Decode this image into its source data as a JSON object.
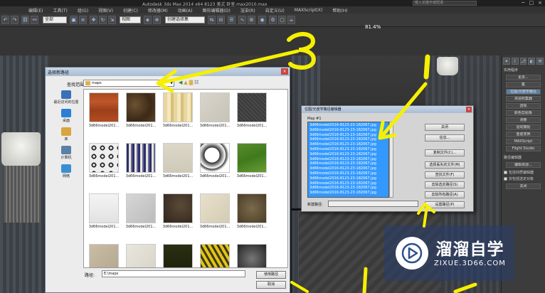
{
  "titlebar": {
    "title": "Autodesk 3ds Max 2014 x64    8123 美式 卧室.max2010.max",
    "search_placeholder": "键入关键字或短语",
    "buttons": [
      "─",
      "□",
      "×"
    ]
  },
  "menubar": [
    "编辑(E)",
    "工具(T)",
    "组(G)",
    "视图(V)",
    "创建(C)",
    "修改器(M)",
    "动画(A)",
    "图形编辑器(D)",
    "渲染(R)",
    "自定义(U)",
    "MAXScript(X)",
    "帮助(H)"
  ],
  "toolbar": {
    "selection_filter": "全部",
    "view_dropdown": "视图",
    "named_selection": "创建选择集"
  },
  "viewport": {
    "zoom_label": "81.4%"
  },
  "command_panel": {
    "header": "实用程序",
    "buttons": [
      "更多...",
      "集",
      "位图/光度学路径",
      "资源收集器",
      "透视",
      "颜色剪贴板",
      "测量",
      "运动捕捉",
      "重置变换",
      "MAXScript",
      "Flight Studio"
    ],
    "section_title": "路径编辑器",
    "edit_btn": "编辑资源...",
    "checkboxes": [
      "包括材质编辑器",
      "仅包括选定对象"
    ],
    "close_btn": "关闭"
  },
  "file_dialog": {
    "title": "选择新路径",
    "lookin_label": "查找范围:",
    "folder": "maps",
    "places": [
      {
        "label": "最近访问的位置",
        "color": "#3b6fb6"
      },
      {
        "label": "桌面",
        "color": "#2b7fd4"
      },
      {
        "label": "库",
        "color": "#d7a640"
      },
      {
        "label": "计算机",
        "color": "#5a7fa8"
      },
      {
        "label": "网络",
        "color": "#3a8fd0"
      }
    ],
    "thumbnails": [
      {
        "caption": "3d66model201...",
        "bg": "linear-gradient(180deg,#a54a1f,#c0562a 30%,#9b3f1a 60%,#b24c22)"
      },
      {
        "caption": "3d66model201...",
        "bg": "radial-gradient(circle at 30% 40%,#6b5232,#3c2a17 60%,#5b4328)"
      },
      {
        "caption": "3d66model201...",
        "bg": "repeating-linear-gradient(90deg,#e8d6a0 0 5px,#f4e8c0 5px 10px,#d8c07a 10px 14px)"
      },
      {
        "caption": "3d66model201...",
        "bg": "linear-gradient(135deg,#d9d5cb,#c7c2b6)"
      },
      {
        "caption": "3d66model201...",
        "bg": "repeating-linear-gradient(45deg,#4a4a4a 0 2px,#3a3a3a 2px 4px)"
      },
      {
        "caption": "3d66model201...",
        "bg": "radial-gradient(circle,#f2f2f2 20%,#222 22%,#222 40%,#eee 42%) 0 0/12px 12px"
      },
      {
        "caption": "3d66model201...",
        "bg": "repeating-linear-gradient(90deg,#2b2f6a 0 3px,#e9e6dc 3px 6px,#6a6a9a 6px 8px)"
      },
      {
        "caption": "3d66model201...",
        "bg": "linear-gradient(180deg,#dcd7c8,#cfc9b8)"
      },
      {
        "caption": "3d66model201...",
        "bg": "radial-gradient(circle at 40% 40%,#fff 30%,#333 32%,#fff 55%,#444 58%,#fff 70%)"
      },
      {
        "caption": "3d66model201...",
        "bg": "linear-gradient(160deg,#5a8c2a,#3f7a1e 50%,#6a9c35)"
      },
      {
        "caption": "3d66model201...",
        "bg": "linear-gradient(180deg,#f4f4f4,#e2e2e2)"
      },
      {
        "caption": "3d66model201...",
        "bg": "linear-gradient(135deg,#d6d6d6,#bcbcbc)"
      },
      {
        "caption": "3d66model201...",
        "bg": "radial-gradient(circle at 60% 40%,#5b4a38,#2f261c)"
      },
      {
        "caption": "3d66model201...",
        "bg": "linear-gradient(135deg,#e8e0cc,#d4cbb3)"
      },
      {
        "caption": "3d66model201...",
        "bg": "radial-gradient(circle at 50% 50%,#7b6a4a,#4a3c28)"
      },
      {
        "caption": "",
        "bg": "linear-gradient(135deg,#c9bda5,#b3a88f)"
      },
      {
        "caption": "",
        "bg": "linear-gradient(135deg,#e9e6de,#d7d3c8)"
      },
      {
        "caption": "",
        "bg": "linear-gradient(180deg,#2a2f14,#1d2008)"
      },
      {
        "caption": "",
        "bg": "repeating-linear-gradient(60deg,#e2c21a 0 4px,#3a3a10 4px 7px)"
      },
      {
        "caption": "",
        "bg": "radial-gradient(circle at 50% 50%,#777,#222)"
      }
    ],
    "path_label": "路径:",
    "path_value": "E:\\maps",
    "use_path_btn": "使用路径",
    "cancel_btn": "取消"
  },
  "path_dialog": {
    "title": "位图/光度学路径编辑器",
    "list_label": "Map #1",
    "files": [
      "3d66model2016-8123-23-182067.jpg",
      "3d66model2016-8123-23-182067.jpg",
      "3d66model2016-8123-23-182067.jpg",
      "3d66model2016-8123-23-182067.jpg",
      "3d66model2016-8123-23-182067.jpg",
      "3d66model2016-8123-23-182067.jpg",
      "3d66model2016-8123-23-182067.jpg",
      "3d66model2016-8123-23-182067.jpg",
      "3d66model2016-8123-23-182067.jpg",
      "3d66model2016-8123-23-182067.jpg",
      "3d66model2016-8123-23-182067.jpg",
      "3d66model2016-8123-23-182067.jpg",
      "3d66model2016-8123-23-182067.jpg",
      "3d66model2016-8123-23-182067.jpg",
      "3d66model2016-8123-23-182067.jpg"
    ],
    "buttons": [
      "关闭",
      "信息...",
      "复制文件(C)...",
      "选择丢失的文件(M)",
      "查找文件(F)",
      "去除选定路径(S)",
      "去除所有路径(A)",
      "设置路径(P)"
    ],
    "new_path_label": "新建路径:",
    "new_path_value": ""
  },
  "annotations": {
    "color": "#f6f000",
    "numbers": [
      "3",
      "1",
      "2"
    ]
  },
  "watermark": {
    "cn": "溜溜自学",
    "en": "ZIXUE.3D66.COM"
  }
}
